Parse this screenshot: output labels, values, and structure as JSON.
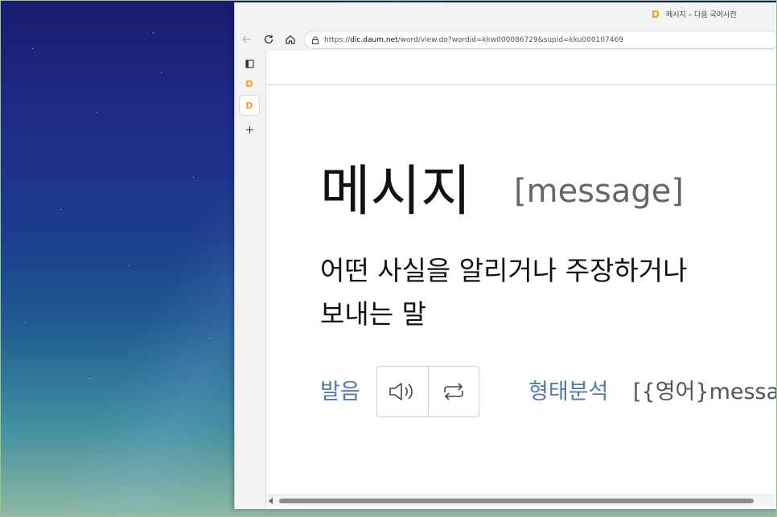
{
  "window": {
    "title": "메시지 – 다음 국어사전",
    "url_prefix": "https://",
    "url_host": "dic.daum.net",
    "url_path": "/word/view.do?wordid=kkw000086729&supid=kku000107469"
  },
  "entry": {
    "headword": "메시지",
    "origin": "[message]",
    "definition_line1": "어떤 사실을 알리거나 주장하거나",
    "definition_line2": "보내는 말",
    "pronunciation_label": "발음",
    "morph_label": "형태분석",
    "morph_value": "[{영어}messag"
  },
  "icons": {
    "back": "arrow-left-icon",
    "reload": "reload-icon",
    "home": "home-icon",
    "lock": "lock-icon",
    "sidebar": "sidebar-panel-icon",
    "favicon": "daum-favicon",
    "new_tab": "plus-icon",
    "speaker": "speaker-icon",
    "repeat": "repeat-icon"
  },
  "colors": {
    "label_blue": "#4f7bb0",
    "text": "#111111",
    "muted": "#666666"
  }
}
